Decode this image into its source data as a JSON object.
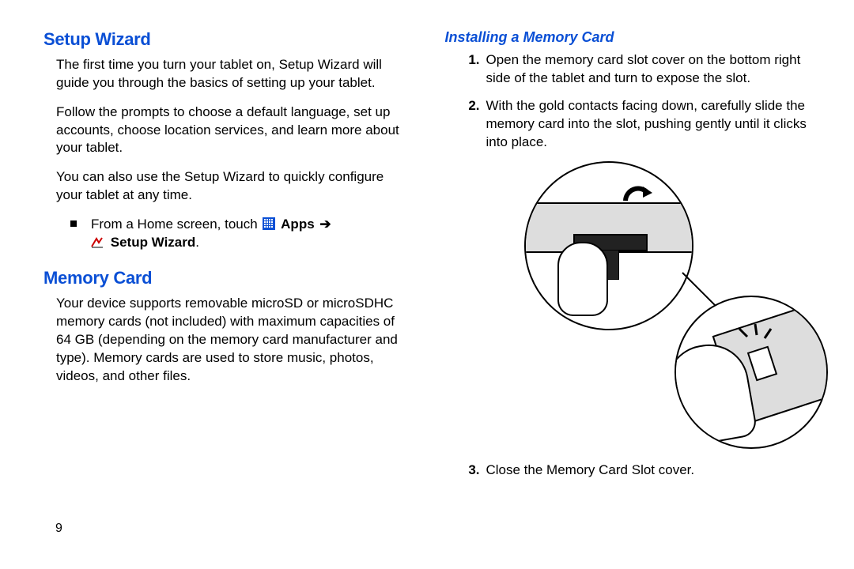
{
  "page_number": "9",
  "left": {
    "setup_heading": "Setup Wizard",
    "setup_p1": "The first time you turn your tablet on, Setup Wizard will guide you through the basics of setting up your tablet.",
    "setup_p2": "Follow the prompts to choose a default language, set up accounts, choose location services, and learn more about your tablet.",
    "setup_p3": "You can also use the Setup Wizard to quickly configure your tablet at any time.",
    "bullet_prefix": "From a Home screen, touch ",
    "apps_label": "Apps",
    "arrow": "➔",
    "wizard_label": "Setup Wizard",
    "period": ".",
    "memory_heading": "Memory Card",
    "memory_p1": "Your device supports removable microSD or microSDHC memory cards (not included) with maximum capacities of 64 GB (depending on the memory card manufacturer and type). Memory cards are used to store music, photos, videos, and other files."
  },
  "right": {
    "install_heading": "Installing a Memory Card",
    "steps": [
      {
        "num": "1.",
        "text": "Open the memory card slot cover on the bottom right side of the tablet and turn to expose the slot."
      },
      {
        "num": "2.",
        "text": "With the gold contacts facing down, carefully slide the memory card into the slot, pushing gently until it clicks into place."
      },
      {
        "num": "3.",
        "text": "Close the Memory Card Slot cover."
      }
    ]
  }
}
